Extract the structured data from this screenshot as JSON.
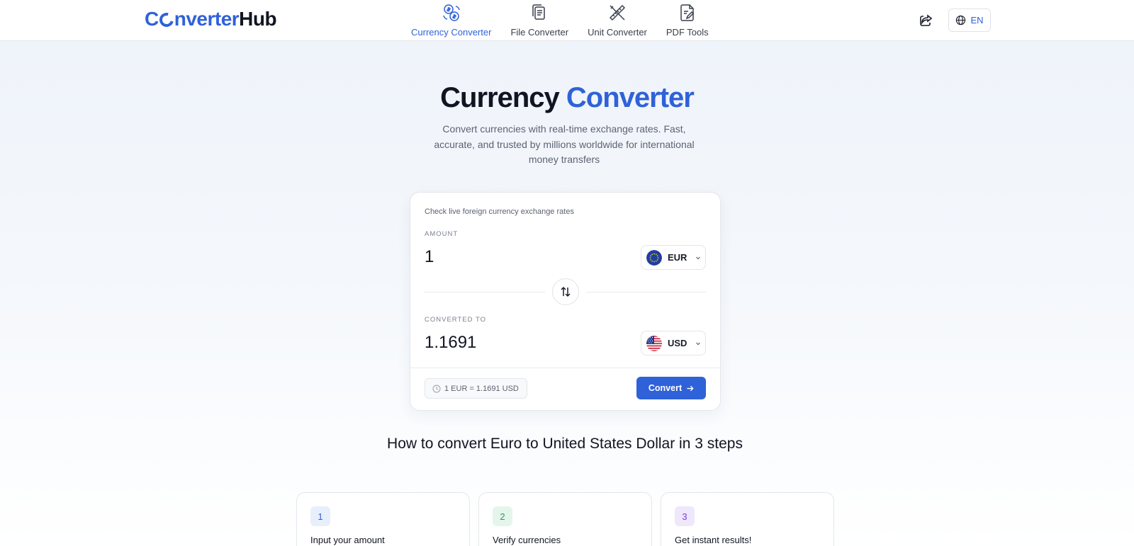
{
  "brand": {
    "part1": "C",
    "part2": "nverter",
    "part3": "Hub"
  },
  "nav": {
    "items": [
      {
        "label": "Currency Converter",
        "icon": "currency-exchange-icon",
        "active": true
      },
      {
        "label": "File Converter",
        "icon": "file-copy-icon",
        "active": false
      },
      {
        "label": "Unit Converter",
        "icon": "ruler-pencil-icon",
        "active": false
      },
      {
        "label": "PDF Tools",
        "icon": "pdf-edit-icon",
        "active": false
      }
    ]
  },
  "header": {
    "language": "EN"
  },
  "hero": {
    "title_dark": "Currency",
    "title_blue": "Converter",
    "subtitle": "Convert currencies with real-time exchange rates. Fast, accurate, and trusted by millions worldwide for international money transfers"
  },
  "converter": {
    "intro": "Check live foreign currency exchange rates",
    "amount_label": "AMOUNT",
    "amount_value": "1",
    "from_currency": "EUR",
    "converted_label": "CONVERTED TO",
    "converted_value": "1.1691",
    "to_currency": "USD",
    "rate_text": "1 EUR = 1.1691 USD",
    "convert_label": "Convert"
  },
  "howto": {
    "title": "How to convert Euro to United States Dollar in 3 steps",
    "steps": [
      {
        "number": "1",
        "title": "Input your amount",
        "accent": "#2f62d8",
        "tint": "#e8effc"
      },
      {
        "number": "2",
        "title": "Verify currencies",
        "accent": "#1f9d5a",
        "tint": "#e4f6ec"
      },
      {
        "number": "3",
        "title": "Get instant results!",
        "accent": "#7b3fd6",
        "tint": "#efe7fb"
      }
    ]
  },
  "colors": {
    "accent": "#2f62d8",
    "text": "#111522",
    "muted": "#5c6272"
  }
}
